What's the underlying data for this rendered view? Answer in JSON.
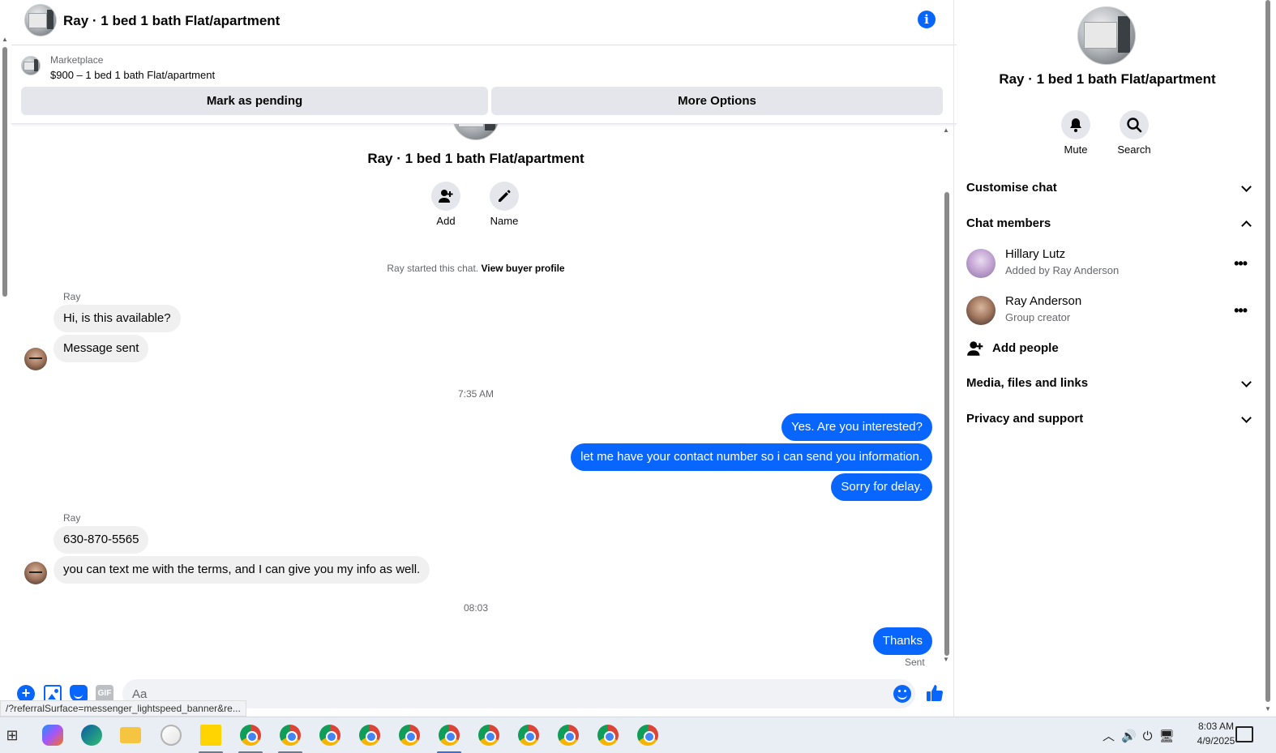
{
  "header": {
    "title": "Ray · 1 bed 1 bath Flat/apartment"
  },
  "marketplace": {
    "label": "Marketplace",
    "listing": "$900 – 1 bed 1 bath Flat/apartment",
    "mark_pending": "Mark as pending",
    "more_options": "More Options"
  },
  "intro": {
    "title": "Ray · 1 bed 1 bath Flat/apartment",
    "add_label": "Add",
    "name_label": "Name",
    "started_text": "Ray started this chat.",
    "buyer_profile_link": "View buyer profile"
  },
  "messages": {
    "sender_1": "Ray",
    "in_1": "Hi, is this available?",
    "in_2": "Message sent",
    "time_1": "7:35 AM",
    "out_1": "Yes. Are you interested?",
    "out_2": "let me have your contact number so i can send you information.",
    "out_3": "Sorry for delay.",
    "sender_2": "Ray",
    "in_3": "630-870-5565",
    "in_4": "you can text me with the terms, and I can give you my info as well.",
    "time_2": "08:03",
    "out_4": "Thanks",
    "sent_status": "Sent"
  },
  "composer": {
    "placeholder": "Aa",
    "gif_label": "GIF"
  },
  "status_url": "/?referralSurface=messenger_lightspeed_banner&re...",
  "right_panel": {
    "title": "Ray · 1 bed 1 bath Flat/apartment",
    "mute_label": "Mute",
    "search_label": "Search",
    "customise_chat": "Customise chat",
    "chat_members": "Chat members",
    "members": [
      {
        "name": "Hillary Lutz",
        "subtitle": "Added by Ray Anderson"
      },
      {
        "name": "Ray Anderson",
        "subtitle": "Group creator"
      }
    ],
    "add_people": "Add people",
    "media_files_links": "Media, files and links",
    "privacy_support": "Privacy and support"
  },
  "taskbar": {
    "time": "8:03 AM",
    "date": "4/9/2025"
  },
  "colors": {
    "accent": "#0866ff",
    "incoming_bubble": "#f0f0f0",
    "button_grey": "#e4e6eb"
  }
}
